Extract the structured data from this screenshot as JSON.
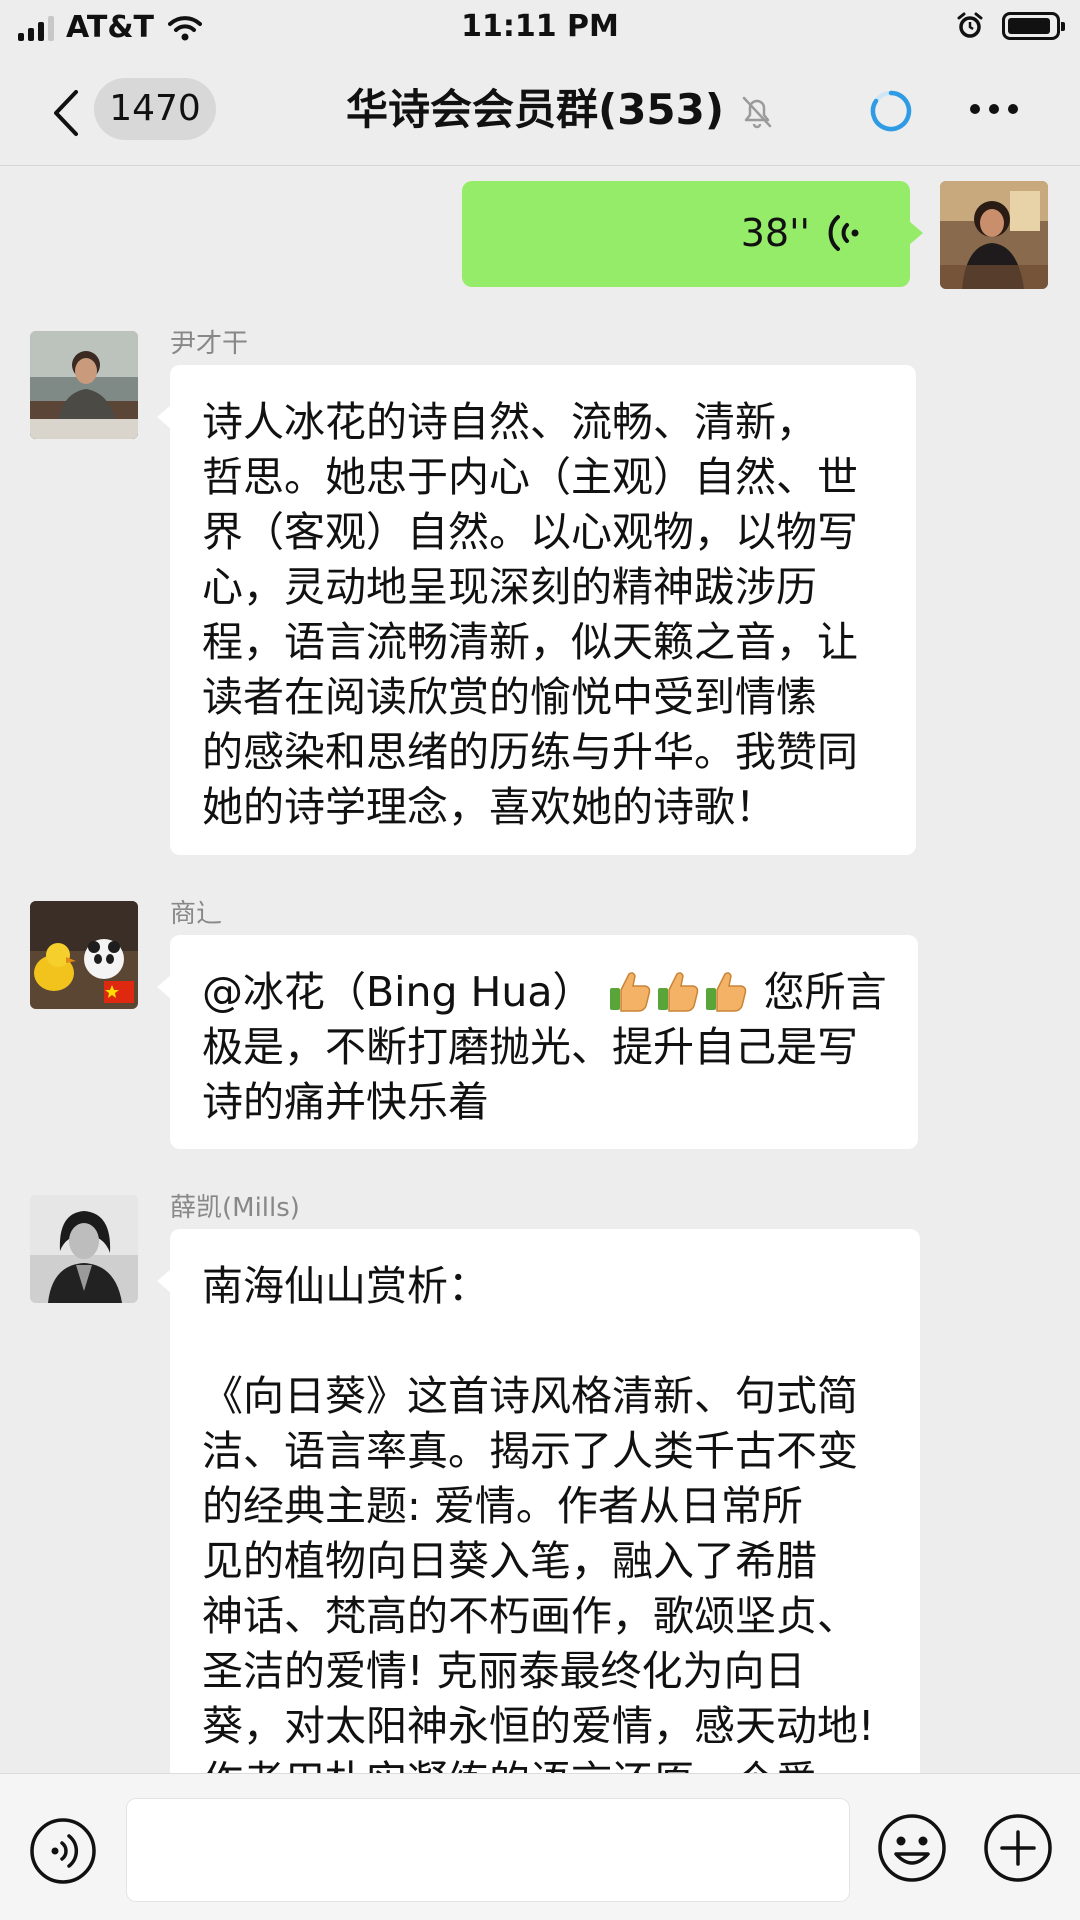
{
  "status_bar": {
    "carrier": "AT&T",
    "time": "11:11 PM",
    "battery_level": 0.92
  },
  "nav": {
    "unread_count": "1470",
    "title": "华诗会会员群(353)",
    "icons": [
      "back-arrow-icon",
      "mute-icon",
      "loading-icon",
      "more-icon"
    ]
  },
  "messages": [
    {
      "type": "voice",
      "from_self": true,
      "duration": "38''"
    },
    {
      "type": "text",
      "sender": "尹才干",
      "lines": [
        "诗人冰花的诗自然、流畅、清新，",
        "哲思。她忠于内心（主观）自然、世",
        "界（客观）自然。以心观物，以物写",
        "心，灵动地呈现深刻的精神跋涉历",
        "程，语言流畅清新，似天籁之音，让",
        "读者在阅读欣赏的愉悦中受到情愫",
        "的感染和思绪的历练与升华。我赞同",
        "她的诗学理念，喜欢她的诗歌！"
      ]
    },
    {
      "type": "text",
      "sender": "商辶",
      "line1_pre": "@冰花（Bing Hua）",
      "line1_post": "您所言",
      "thumbs_emoji_count": 3,
      "lines": [
        "极是，不断打磨抛光、提升自己是写",
        "诗的痛并快乐着"
      ]
    },
    {
      "type": "text",
      "sender": "薛凯(Mills)",
      "lines": [
        "南海仙山赏析：",
        "",
        "《向日葵》这首诗风格清新、句式简",
        "洁、语言率真。揭示了人类千古不变",
        "的经典主题: 爱情。作者从日常所",
        "见的植物向日葵入笔，融入了希腊",
        "神话、梵高的不朽画作，歌颂坚贞、",
        "圣洁的爱情! 克丽泰最终化为向日",
        "葵，对太阳神永恒的爱情，感天动地!",
        "作者用朴实凝练的语言还原一个爱"
      ]
    }
  ],
  "input_bar": {
    "icons": [
      "voice-toggle-icon",
      "emoji-icon",
      "plus-icon"
    ],
    "text_value": ""
  },
  "colors": {
    "background": "#ededed",
    "self_bubble": "#95ec69",
    "other_bubble": "#ffffff",
    "loading_accent": "#2f9be4"
  }
}
